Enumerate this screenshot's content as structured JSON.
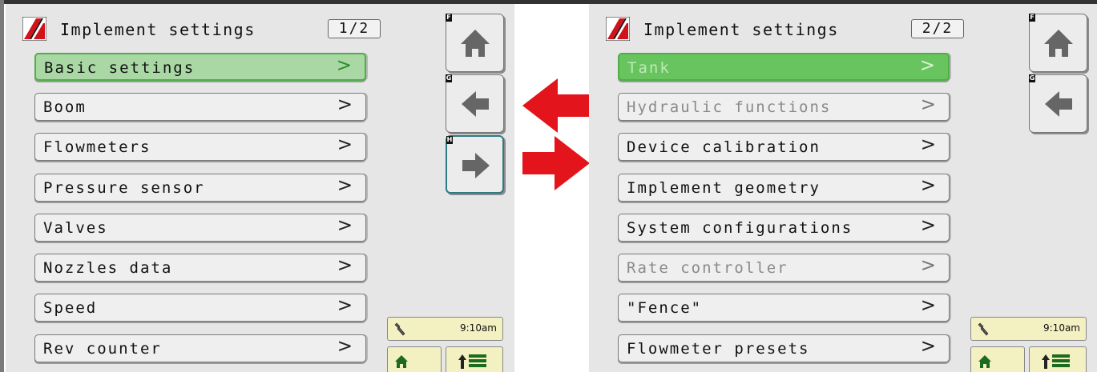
{
  "screens": [
    {
      "title": "Implement settings",
      "page_indicator": "1/2",
      "items": [
        {
          "label": "Basic settings",
          "chevron": ">"
        },
        {
          "label": "Boom",
          "chevron": ">"
        },
        {
          "label": "Flowmeters",
          "chevron": ">"
        },
        {
          "label": "Pressure sensor",
          "chevron": ">"
        },
        {
          "label": "Valves",
          "chevron": ">"
        },
        {
          "label": "Nozzles data",
          "chevron": ">"
        },
        {
          "label": "Speed",
          "chevron": ">"
        },
        {
          "label": "Rev counter",
          "chevron": ">"
        }
      ],
      "softkeys": [
        "F",
        "G",
        "H"
      ],
      "status": {
        "time": "9:10am"
      }
    },
    {
      "title": "Implement settings",
      "page_indicator": "2/2",
      "items": [
        {
          "label": "Tank",
          "chevron": ">"
        },
        {
          "label": "Hydraulic functions",
          "chevron": ">"
        },
        {
          "label": "Device calibration",
          "chevron": ">"
        },
        {
          "label": "Implement geometry",
          "chevron": ">"
        },
        {
          "label": "System configurations",
          "chevron": ">"
        },
        {
          "label": "Rate controller",
          "chevron": ">"
        },
        {
          "label": "\"Fence\"",
          "chevron": ">"
        },
        {
          "label": "Flowmeter presets",
          "chevron": ">"
        }
      ],
      "softkeys": [
        "F",
        "G"
      ],
      "status": {
        "time": "9:10am"
      }
    }
  ],
  "icons": {
    "logo": "brand-logo",
    "home": "home-icon",
    "back": "arrow-left-icon",
    "next": "arrow-right-icon",
    "wrench": "wrench-icon",
    "up_list": "up-list-icon"
  },
  "colors": {
    "selected_fill": "#a9d8a4",
    "selected_border": "#4fae46",
    "active_fill": "#68c45e",
    "transition_arrow": "#e3141b",
    "status_bg": "#f3f0c2",
    "highlight_border": "#2b7a86"
  }
}
